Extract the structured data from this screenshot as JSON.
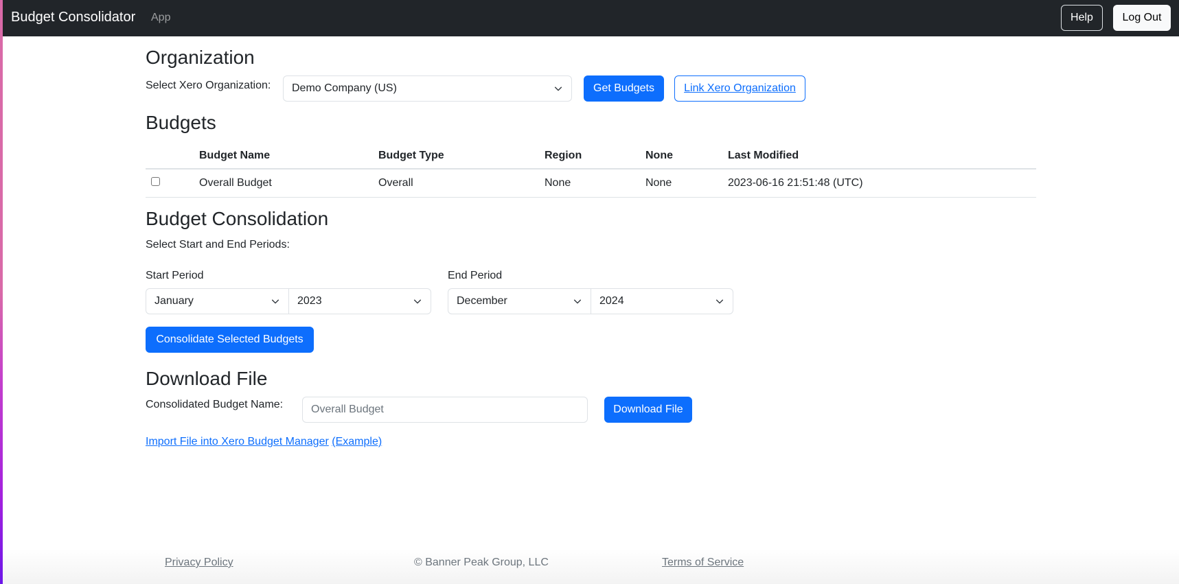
{
  "navbar": {
    "brand": "Budget Consolidator",
    "nav_items": [
      "App"
    ],
    "help_label": "Help",
    "logout_label": "Log Out"
  },
  "organization": {
    "heading": "Organization",
    "select_label": "Select Xero Organization:",
    "selected_org": "Demo Company (US)",
    "get_budgets_label": "Get Budgets",
    "link_org_label": "Link Xero Organization"
  },
  "budgets": {
    "heading": "Budgets",
    "columns": [
      "",
      "Budget Name",
      "Budget Type",
      "Region",
      "None",
      "Last Modified"
    ],
    "rows": [
      {
        "checked": false,
        "name": "Overall Budget",
        "type": "Overall",
        "region": "None",
        "none": "None",
        "last_modified": "2023-06-16 21:51:48 (UTC)"
      }
    ]
  },
  "consolidation": {
    "heading": "Budget Consolidation",
    "instructions": "Select Start and End Periods:",
    "start_label": "Start Period",
    "start_month": "January",
    "start_year": "2023",
    "end_label": "End Period",
    "end_month": "December",
    "end_year": "2024",
    "consolidate_label": "Consolidate Selected Budgets"
  },
  "download": {
    "heading": "Download File",
    "name_label": "Consolidated Budget Name:",
    "name_value": "",
    "name_placeholder": "Overall Budget",
    "download_label": "Download File",
    "import_link": "Import File into Xero Budget Manager",
    "example_link": "(Example)"
  },
  "footer": {
    "privacy": "Privacy Policy",
    "copyright": "© Banner Peak Group, LLC",
    "terms": "Terms of Service"
  },
  "colors": {
    "navbar_bg": "#212529",
    "primary": "#0d6efd",
    "text": "#212529",
    "muted": "#6c757d",
    "border": "#dee2e6"
  }
}
